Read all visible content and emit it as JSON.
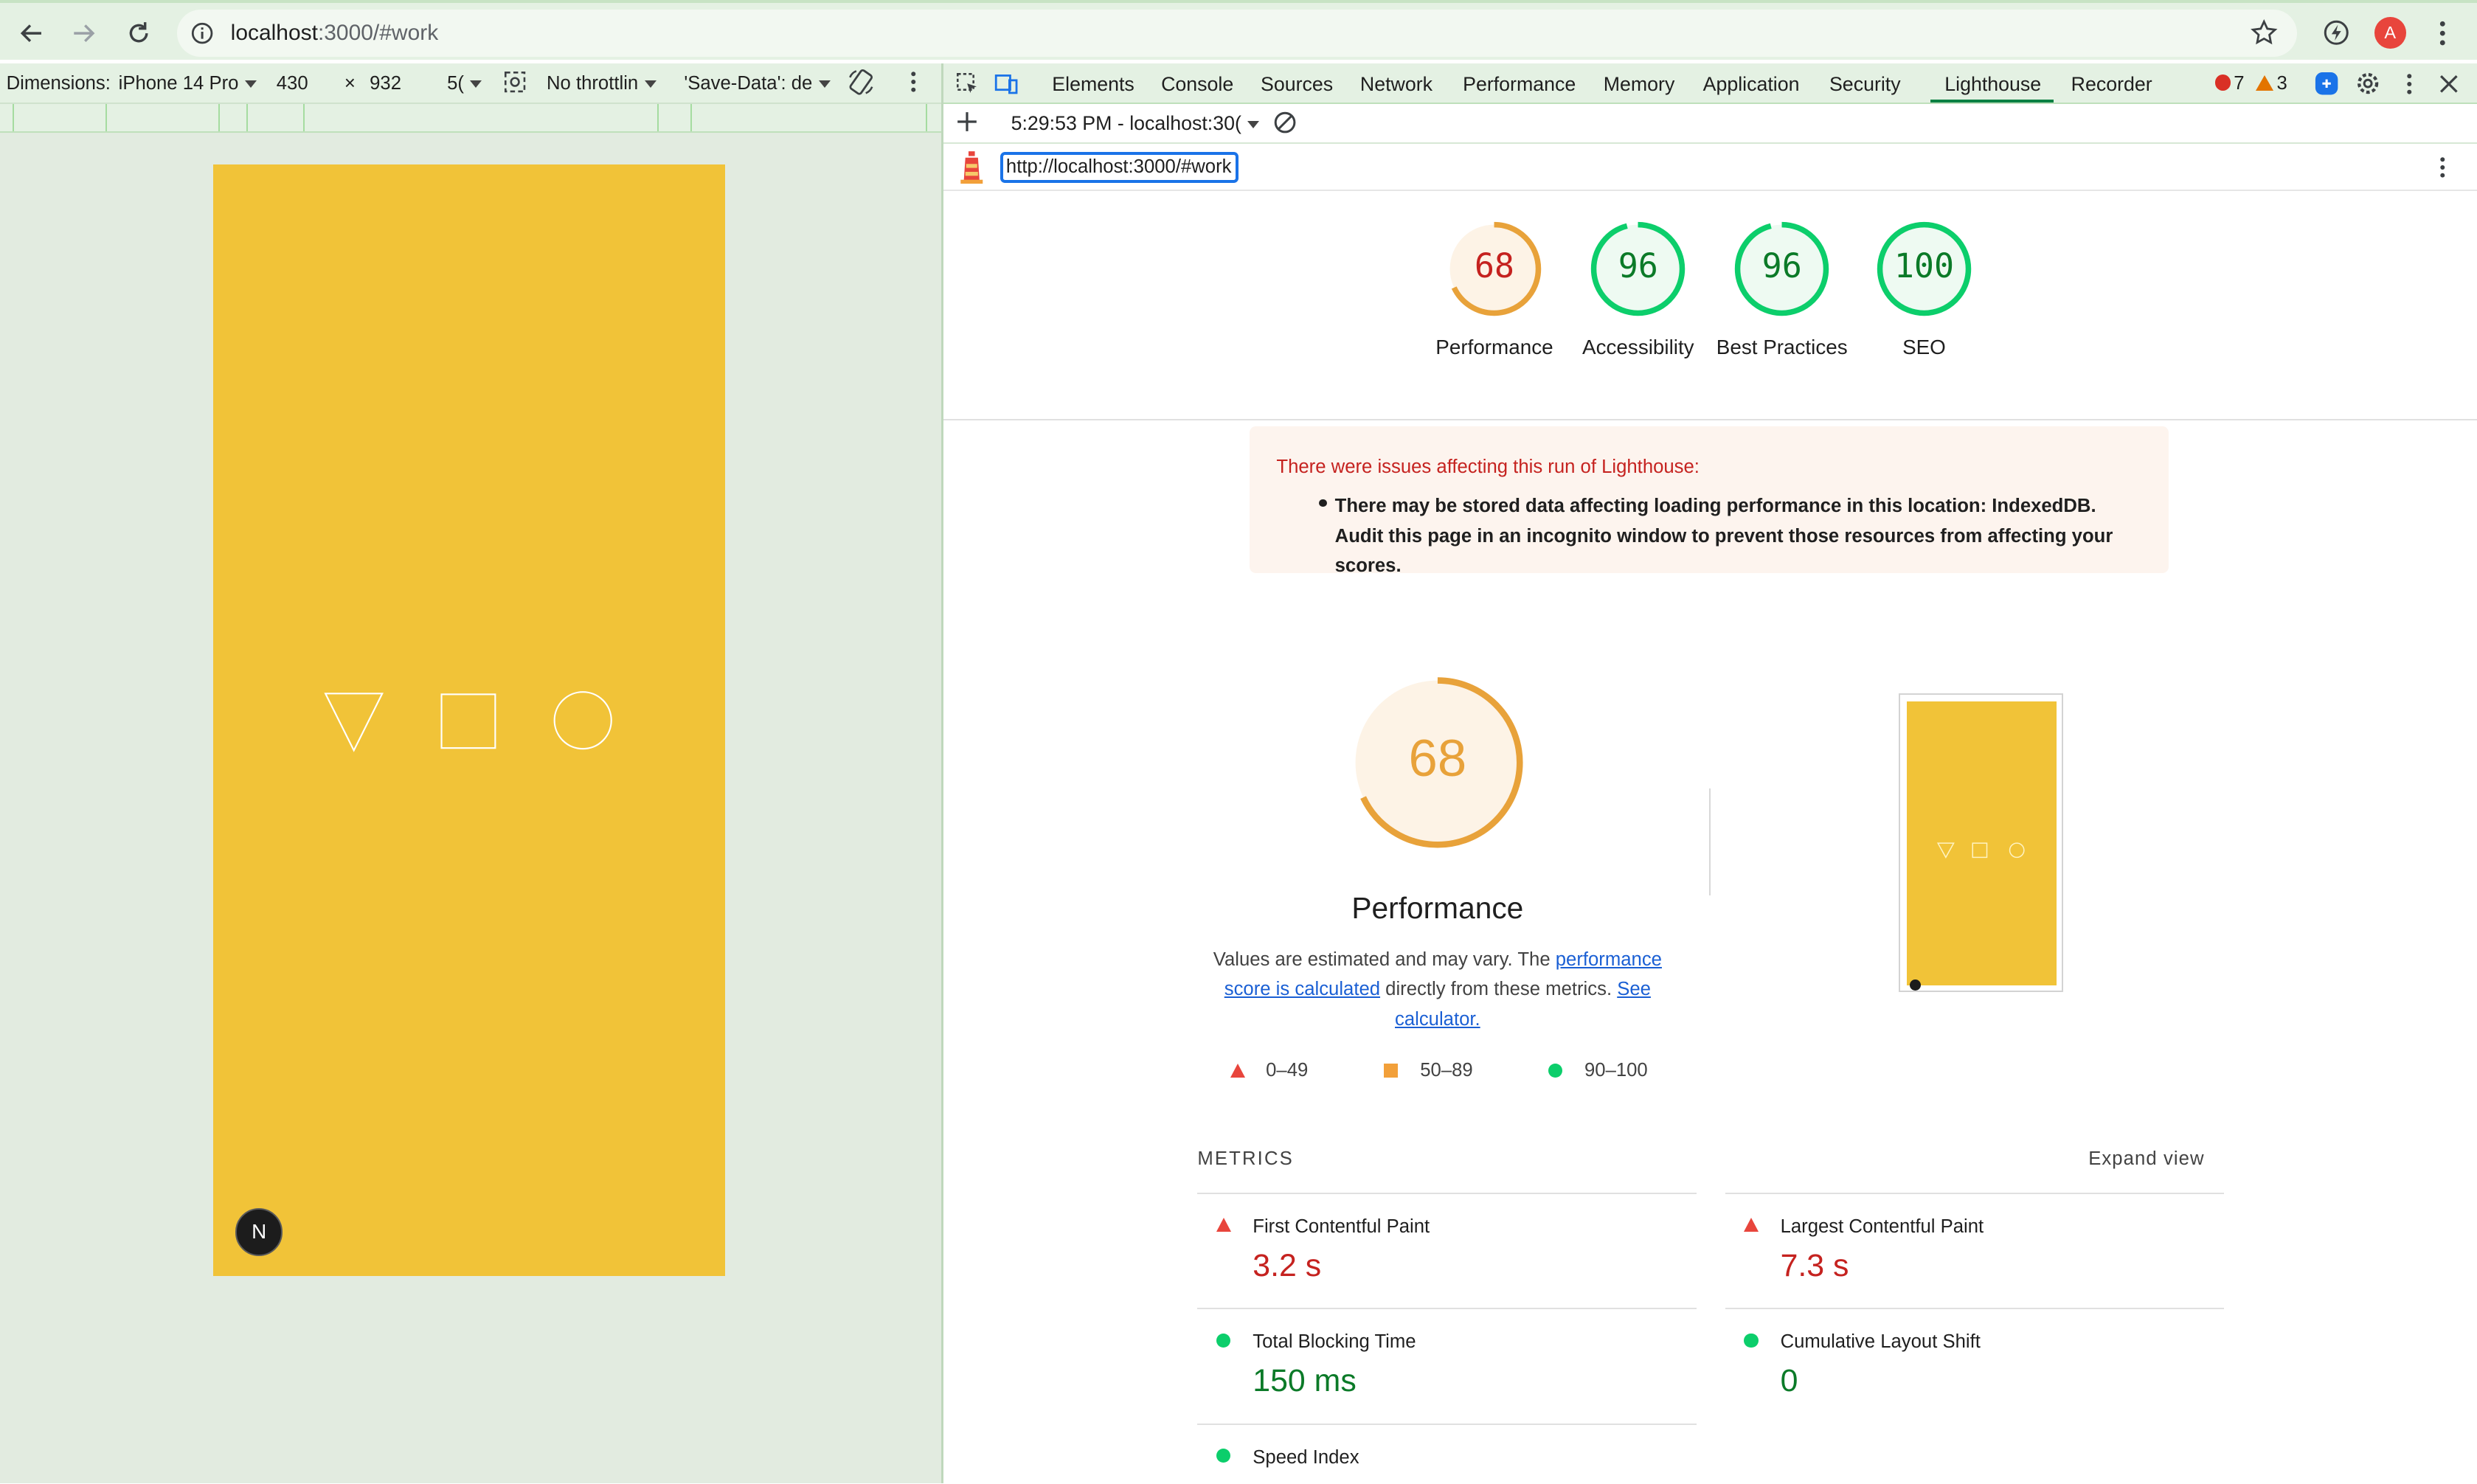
{
  "browser": {
    "url_host": "localhost",
    "url_rest": ":3000/#work",
    "avatar_letter": "A"
  },
  "device_toolbar": {
    "dimensions_label": "Dimensions:",
    "device": "iPhone 14 Pro",
    "width": "430",
    "times": "×",
    "height": "932",
    "zoom": "5(",
    "throttling": "No throttlin",
    "save_data": "'Save-Data': de"
  },
  "phone": {
    "next_badge": "N"
  },
  "devtools": {
    "tabs": [
      "Elements",
      "Console",
      "Sources",
      "Network",
      "Performance",
      "Memory",
      "Application",
      "Security",
      "Lighthouse",
      "Recorder"
    ],
    "active_tab": "Lighthouse",
    "error_count": "7",
    "warning_count": "3"
  },
  "lighthouse": {
    "report_selector": "5:29:53 PM - localhost:30(",
    "report_url": "http://localhost:3000/#work",
    "gauges": [
      {
        "score": 68,
        "label": "Performance",
        "color": "#e8a23a",
        "text_color": "#c5221f"
      },
      {
        "score": 96,
        "label": "Accessibility",
        "color": "#0cce6b",
        "text_color": "#0b7a28"
      },
      {
        "score": 96,
        "label": "Best Practices",
        "color": "#0cce6b",
        "text_color": "#0b7a28"
      },
      {
        "score": 100,
        "label": "SEO",
        "color": "#0cce6b",
        "text_color": "#0b7a28"
      }
    ],
    "warning": {
      "title": "There were issues affecting this run of Lighthouse:",
      "message": "There may be stored data affecting loading performance in this location: IndexedDB. Audit this page in an incognito window to prevent those resources from affecting your scores."
    },
    "performance": {
      "score": "68",
      "title": "Performance",
      "desc_prefix": "Values are estimated and may vary. The ",
      "desc_link1": "performance score is calculated",
      "desc_middle": " directly from these metrics. ",
      "desc_link2": "See calculator."
    },
    "legend": {
      "fail": "0–49",
      "average": "50–89",
      "pass": "90–100"
    },
    "metrics": {
      "heading": "METRICS",
      "expand": "Expand view",
      "items": [
        {
          "label": "First Contentful Paint",
          "value": "3.2 s",
          "status": "fail"
        },
        {
          "label": "Largest Contentful Paint",
          "value": "7.3 s",
          "status": "fail"
        },
        {
          "label": "Total Blocking Time",
          "value": "150 ms",
          "status": "pass"
        },
        {
          "label": "Cumulative Layout Shift",
          "value": "0",
          "status": "pass"
        },
        {
          "label": "Speed Index",
          "value": "",
          "status": "pass"
        }
      ]
    }
  }
}
